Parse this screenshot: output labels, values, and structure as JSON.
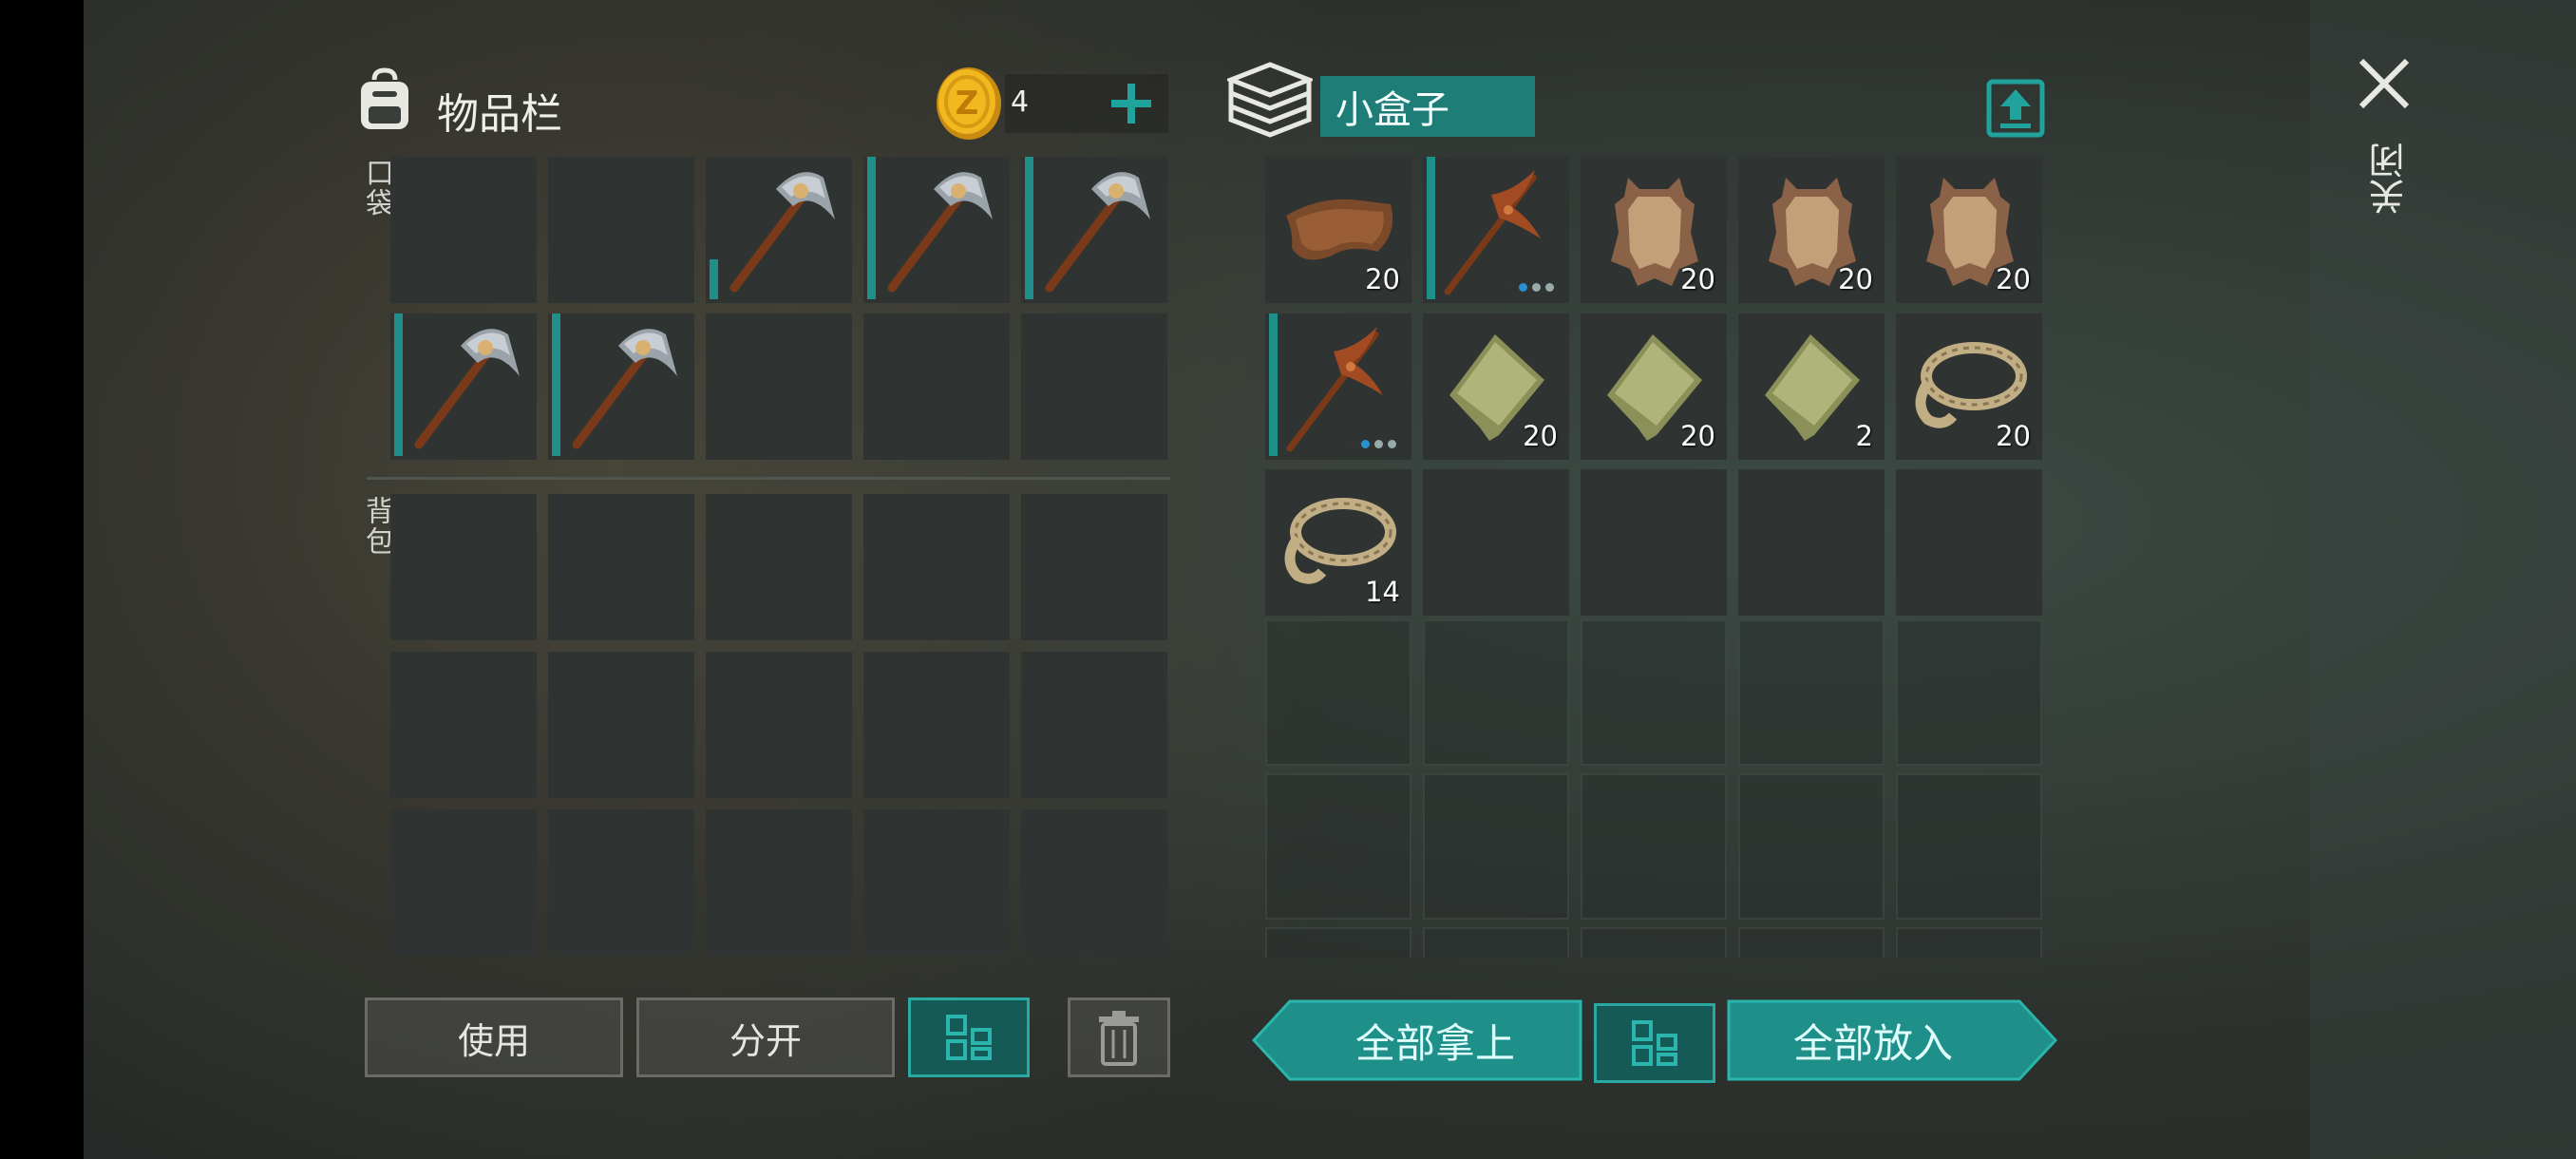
{
  "inventory": {
    "title": "物品栏",
    "coin_count": "4",
    "pocket_label": "口袋",
    "backpack_label": "背包",
    "pocket_slots": [
      {
        "item": "",
        "count": ""
      },
      {
        "item": "",
        "count": ""
      },
      {
        "item": "pickaxe",
        "count": ""
      },
      {
        "item": "pickaxe",
        "count": ""
      },
      {
        "item": "pickaxe",
        "count": ""
      },
      {
        "item": "pickaxe",
        "count": ""
      },
      {
        "item": "pickaxe",
        "count": ""
      },
      {
        "item": "",
        "count": ""
      },
      {
        "item": "",
        "count": ""
      },
      {
        "item": "",
        "count": ""
      }
    ]
  },
  "container": {
    "title": "小盒子",
    "slots": [
      {
        "item": "leather",
        "count": "20"
      },
      {
        "item": "wood-pickaxe",
        "count": ""
      },
      {
        "item": "hide",
        "count": "20"
      },
      {
        "item": "hide",
        "count": "20"
      },
      {
        "item": "hide",
        "count": "20"
      },
      {
        "item": "wood-pickaxe",
        "count": ""
      },
      {
        "item": "cloth",
        "count": "20"
      },
      {
        "item": "cloth",
        "count": "20"
      },
      {
        "item": "cloth",
        "count": "2"
      },
      {
        "item": "rope",
        "count": "20"
      },
      {
        "item": "rope",
        "count": "14"
      }
    ]
  },
  "actions": {
    "use": "使用",
    "split": "分开",
    "take_all": "全部拿上",
    "put_all": "全部放入"
  },
  "close_label": "关闭",
  "icons": [
    "backpack-icon",
    "coin-icon",
    "plus-icon",
    "box-icon",
    "upload-icon",
    "close-icon",
    "grid-icon",
    "trash-icon"
  ],
  "colors": {
    "accent": "#1f8f8a",
    "accent_dark": "#155a57",
    "slot": "#2f3331"
  }
}
